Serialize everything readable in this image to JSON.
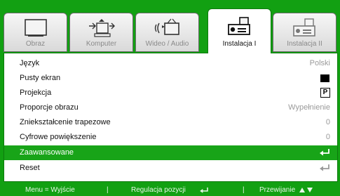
{
  "tabs": [
    {
      "label": "Obraz",
      "icon": "monitor-icon"
    },
    {
      "label": "Komputer",
      "icon": "computer-icon"
    },
    {
      "label": "Wideo / Audio",
      "icon": "video-audio-icon"
    },
    {
      "label": "Instalacja I",
      "icon": "projector-icon",
      "active": true
    },
    {
      "label": "Instalacja II",
      "icon": "projector-settings-icon"
    }
  ],
  "menu": {
    "items": [
      {
        "label": "Język",
        "value": "Polski"
      },
      {
        "label": "Pusty ekran",
        "value_icon": "black-swatch"
      },
      {
        "label": "Projekcja",
        "value": "P"
      },
      {
        "label": "Proporcje obrazu",
        "value": "Wypełnienie"
      },
      {
        "label": "Zniekształcenie trapezowe",
        "value": "0"
      },
      {
        "label": "Cyfrowe powiększenie",
        "value": "0"
      },
      {
        "label": "Zaawansowane",
        "value_icon": "enter-icon",
        "selected": true
      },
      {
        "label": "Reset",
        "value_icon": "enter-icon"
      }
    ]
  },
  "hint_bar": {
    "menu_exit": "Menu = Wyjście",
    "adjust": "Regulacja pozycji",
    "scroll": "Przewijanie"
  },
  "colors": {
    "frame_green": "#12a012",
    "selection_green": "#18a418",
    "value_gray": "#9a9a9a"
  }
}
